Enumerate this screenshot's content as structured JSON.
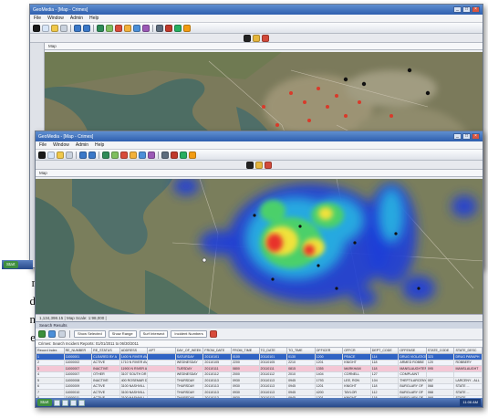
{
  "background_text": [
    "r",
    "d",
    "n",
    "e"
  ],
  "back_window": {
    "title": "GeoMedia - [Map - Crimes]",
    "menu": [
      "File",
      "Window",
      "Admin",
      "Help"
    ],
    "tab": "Map",
    "start_label": "Start"
  },
  "front_window": {
    "title": "GeoMedia - [Map - Crimes]",
    "menu": [
      "File",
      "Window",
      "Admin",
      "Help"
    ],
    "tab": "Map",
    "status_coords": "1,134,398.15   |   Map Scale: 1:98,000  |",
    "search_title": "Search Results",
    "search_buttons": [
      "Show Selected",
      "Show Range",
      "Surf Intersect",
      "Incident Numbers"
    ],
    "query_line": "Crimes: Search Incident Reports: 01/01/2011 to 06/30/2011",
    "table": {
      "columns": [
        "Record Index",
        "RE_NUMBER",
        "RE_STATUS",
        "ADDRESS",
        "APT",
        "DAY_OF_WEEK",
        "FROM_DATE",
        "FROM_TIME",
        "TO_DATE",
        "TO_TIME",
        "OFFICER",
        "OFFCR",
        "DEPT_CODE",
        "OFFENSE",
        "STATE_CODE",
        "STATE_DESC"
      ],
      "rows": [
        [
          "1",
          "11000001",
          "CLEARED BY A",
          "1400 N RIVER AVE",
          "",
          "SATURDAY",
          "20110101",
          "0100",
          "20110101",
          "0130",
          "1200",
          "PEACE",
          "114",
          "DRUG VIOLATION",
          "323",
          "DRUG PARAPH"
        ],
        [
          "2",
          "11000002",
          "ACTIVE",
          "1710 N RIVER AVE",
          "",
          "WEDNESDAY",
          "20110105",
          "2200",
          "20110105",
          "2210",
          "1201",
          "KNIGHT",
          "118",
          "ARMED ROBBE",
          "120",
          "ROBBERY"
        ],
        [
          "3",
          "11000007",
          "INACTIVE",
          "11900 N RIVER AVE",
          "",
          "TUESDAY",
          "20110111",
          "0800",
          "20110111",
          "0815",
          "1355",
          "MARKHAM",
          "118",
          "MANSLAUGHTER",
          "095",
          "MANSLAUGHT"
        ],
        [
          "4",
          "11000007",
          "OTHER",
          "3107 SOUTH DR",
          "",
          "WEDNESDAY",
          "20110112",
          "2000",
          "20110112",
          "2010",
          "1404",
          "CORNELL",
          "127",
          "COMPLAINT",
          "",
          ""
        ],
        [
          "5",
          "11000008",
          "INACTIVE",
          "400 ROSEMAR DR",
          "",
          "THURSDAY",
          "20110113",
          "0930",
          "20110113",
          "0945",
          "1793",
          "LEE, RON",
          "104",
          "THEFT/LARCENY",
          "057",
          "LARCENY - ALL"
        ],
        [
          "6",
          "11000009",
          "ACTIVE",
          "3100 NASHVILL",
          "",
          "THURSDAY",
          "20110113",
          "0930",
          "20110113",
          "0945",
          "1201",
          "KNIGHT",
          "118",
          "BURGLARY OF",
          "068",
          "STATE ..."
        ],
        [
          "7",
          "11000010",
          "ACTIVE",
          "3100 NASHVILL",
          "",
          "THURSDAY",
          "20110113",
          "0930",
          "20110113",
          "0945",
          "4200",
          "TAYLOR",
          "112",
          "BURGLARY OF",
          "068",
          "STATE ..."
        ],
        [
          "8",
          "11000011",
          "ACTIVE",
          "3100 NASHVILL",
          "",
          "THURSDAY",
          "20110113",
          "0930",
          "20110113",
          "0945",
          "1201",
          "KNIGHT",
          "118",
          "BURGLARY OF",
          "068",
          "STATE ..."
        ],
        [
          "9",
          "11000012",
          "CLEARED BY A",
          "1000 OLD MILL",
          "",
          "FRIDAY",
          "20110114",
          "1400",
          "20110114",
          "1415",
          "1725",
          "COOL, J",
          "118",
          "THEFT/LARCENY",
          "067",
          "STATE ..."
        ]
      ]
    },
    "start_label": "Start",
    "clock": "11:06 AM"
  }
}
